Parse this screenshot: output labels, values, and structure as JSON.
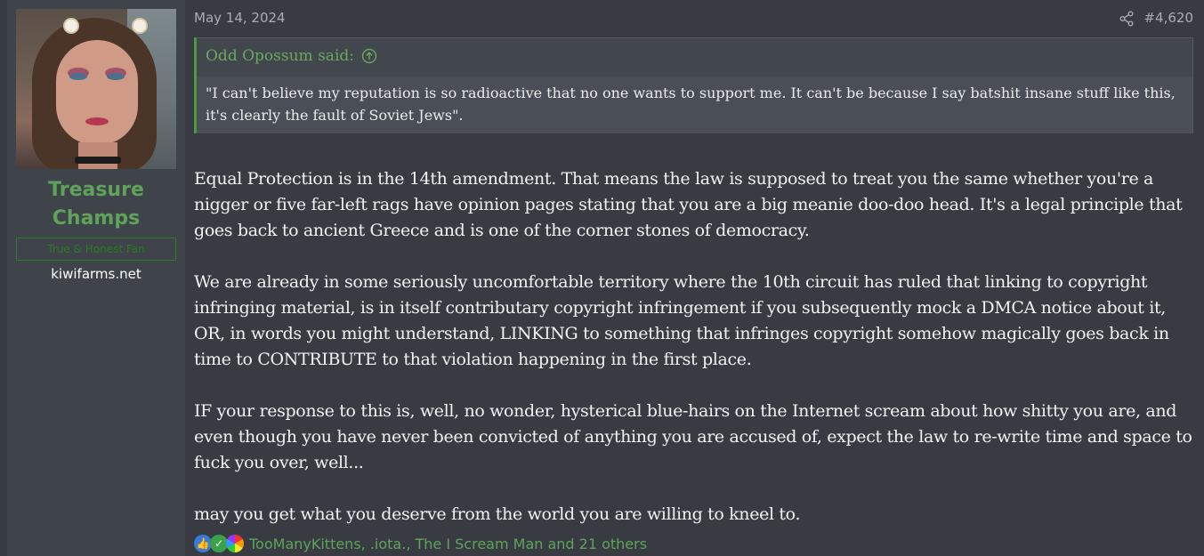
{
  "user": {
    "name_line1": "Treasure",
    "name_line2": "Champs",
    "title": "True & Honest Fan",
    "site": "kiwifarms.net"
  },
  "post": {
    "date": "May 14, 2024",
    "number": "#4,620",
    "quote_author": "Odd Opossum said:",
    "quote_text": "\"I can't believe my reputation is so radioactive that no one wants to support me. It can't be because I say batshit insane stuff like this, it's clearly the fault of Soviet Jews\".",
    "paragraphs": [
      "Equal Protection is in the 14th amendment. That means the law is supposed to treat you the same whether you're a nigger or five far-left rags have opinion pages stating that you are a big meanie doo-doo head. It's a legal principle that goes back to ancient Greece and is one of the corner stones of democracy.",
      "We are already in some seriously uncomfortable territory where the 10th circuit has ruled that linking to copyright infringing material, is in itself contributary copyright infringement if you subsequently mock a DMCA notice about it, OR, in words you might understand, LINKING to something that infringes copyright somehow magically goes back in time to CONTRIBUTE to that violation happening in the first place.",
      "IF your response to this is, well, no wonder, hysterical blue-hairs on the Internet scream about how shitty you are, and even though you have never been convicted of anything you are accused of, expect the law to re-write time and space to fuck you over, well...",
      "may you get what you deserve from the world you are willing to kneel to."
    ],
    "reactions": {
      "icons": [
        "like-icon",
        "check-icon",
        "rainbow-icon"
      ],
      "names": "TooManyKittens, .iota., The I Scream Man and 21 others"
    }
  },
  "colors": {
    "background": "#383c42",
    "user_column": "#3f444b",
    "accent_green": "#5fa35a",
    "quote_border": "#4e9a3e"
  }
}
